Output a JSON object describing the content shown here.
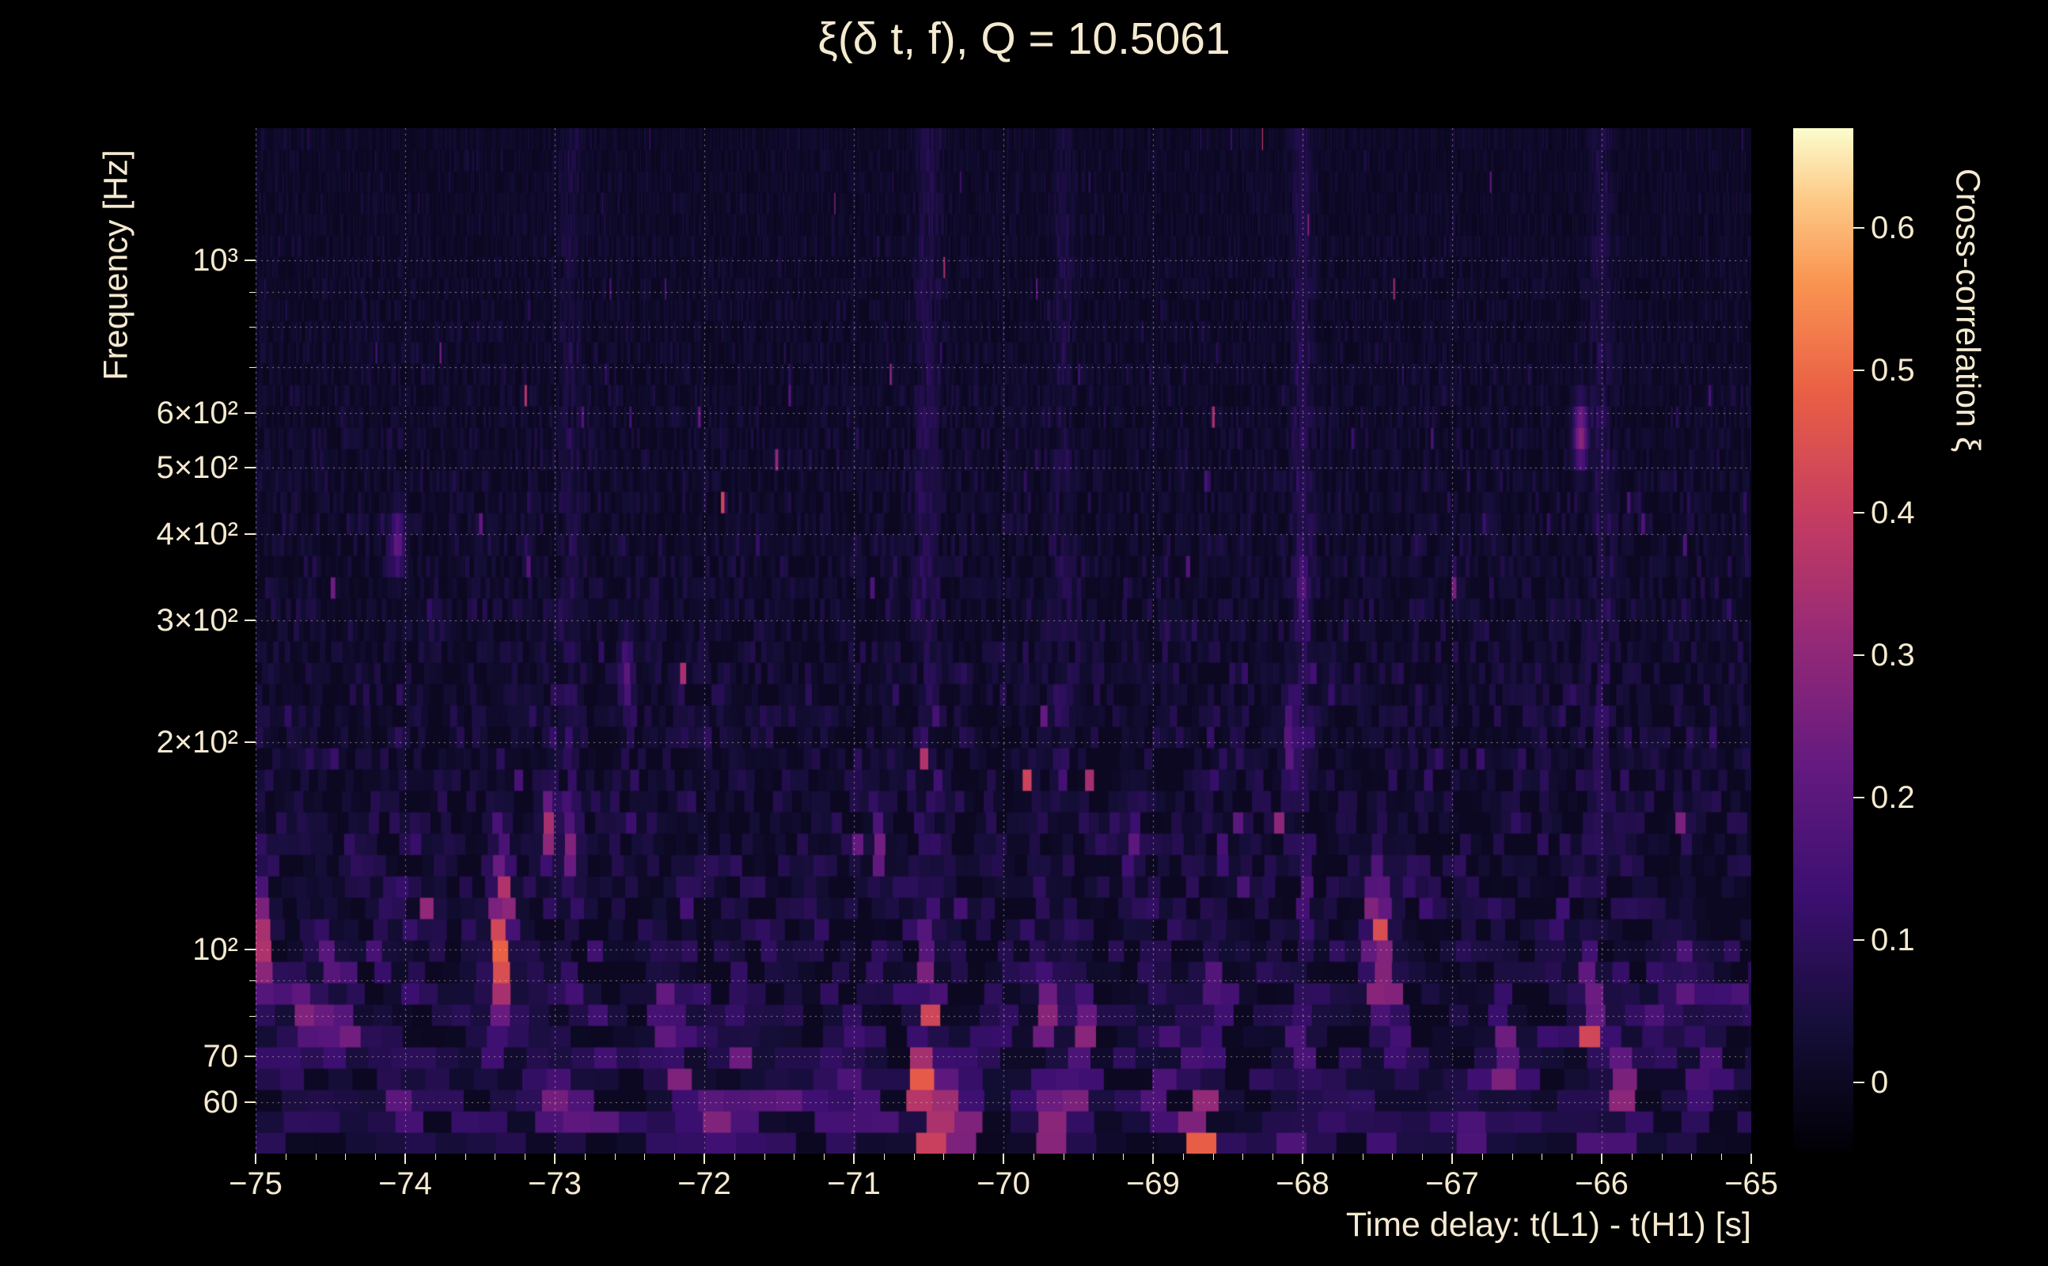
{
  "chart_data": {
    "type": "heatmap",
    "title": "ξ(δ t, f), Q = 10.5061",
    "q": 10.5061,
    "xlabel": "Time delay: t(L1) - t(H1) [s]",
    "ylabel": "Frequency [Hz]",
    "x_range": [
      -75,
      -65
    ],
    "y_range": [
      50.5,
      1555
    ],
    "y_scale": "log",
    "x_ticks": [
      {
        "t": -75,
        "label": "−75"
      },
      {
        "t": -74,
        "label": "−74"
      },
      {
        "t": -73,
        "label": "−73"
      },
      {
        "t": -72,
        "label": "−72"
      },
      {
        "t": -71,
        "label": "−71"
      },
      {
        "t": -70,
        "label": "−70"
      },
      {
        "t": -69,
        "label": "−69"
      },
      {
        "t": -68,
        "label": "−68"
      },
      {
        "t": -67,
        "label": "−67"
      },
      {
        "t": -66,
        "label": "−66"
      },
      {
        "t": -65,
        "label": "−65"
      }
    ],
    "x_minor_step": 0.2,
    "y_major_ticks": [
      {
        "f": 1000,
        "label": "10³"
      },
      {
        "f": 600,
        "label": "6×10²"
      },
      {
        "f": 500,
        "label": "5×10²"
      },
      {
        "f": 400,
        "label": "4×10²"
      },
      {
        "f": 300,
        "label": "3×10²"
      },
      {
        "f": 200,
        "label": "2×10²"
      },
      {
        "f": 100,
        "label": "10²"
      },
      {
        "f": 70,
        "label": "70"
      },
      {
        "f": 60,
        "label": "60"
      }
    ],
    "y_minor_ticks": [
      900,
      800,
      700,
      90,
      80
    ],
    "grid_freqs": [
      60,
      70,
      80,
      90,
      100,
      200,
      300,
      400,
      500,
      600,
      700,
      800,
      900,
      1000
    ],
    "grid_on": true,
    "colorbar": {
      "label": "Cross-correlation ξ",
      "vmin": -0.05,
      "vmax": 0.67,
      "ticks": [
        {
          "v": 0.6,
          "label": "0.6"
        },
        {
          "v": 0.5,
          "label": "0.5"
        },
        {
          "v": 0.4,
          "label": "0.4"
        },
        {
          "v": 0.3,
          "label": "0.3"
        },
        {
          "v": 0.2,
          "label": "0.2"
        },
        {
          "v": 0.1,
          "label": "0.1"
        },
        {
          "v": 0.0,
          "label": "0"
        }
      ]
    },
    "colormap": "magma",
    "colormap_stops": [
      [
        0.0,
        [
          0,
          0,
          4
        ]
      ],
      [
        0.12,
        [
          20,
          14,
          54
        ]
      ],
      [
        0.25,
        [
          59,
          15,
          112
        ]
      ],
      [
        0.38,
        [
          101,
          26,
          128
        ]
      ],
      [
        0.5,
        [
          148,
          41,
          119
        ]
      ],
      [
        0.62,
        [
          196,
          60,
          98
        ]
      ],
      [
        0.74,
        [
          233,
          94,
          69
        ]
      ],
      [
        0.85,
        [
          250,
          148,
          82
        ]
      ],
      [
        0.93,
        [
          253,
          201,
          134
        ]
      ],
      [
        1.0,
        [
          252,
          252,
          205
        ]
      ]
    ],
    "noise": {
      "seed": 1226,
      "rows": 48,
      "base_sigma": 0.018,
      "lowfreq_sigma": 0.05,
      "base_mean": 0.012,
      "lowfreq_mean": 0.02,
      "spike_prob_hi": 0.004,
      "spike_prob_lo": 0.025,
      "spike_scale": 0.35
    },
    "bands": [
      {
        "x": -72.9,
        "v": 0.04,
        "dx": 0.05
      },
      {
        "x": -70.5,
        "v": 0.055,
        "dx": 0.06
      },
      {
        "x": -69.6,
        "v": 0.04,
        "dx": 0.05
      },
      {
        "x": -68.0,
        "v": 0.06,
        "dx": 0.05
      },
      {
        "x": -66.0,
        "v": 0.05,
        "dx": 0.05
      }
    ],
    "hotspots": [
      {
        "x": -74.97,
        "f": 100,
        "v": 0.44
      },
      {
        "x": -74.8,
        "f": 60,
        "v": 0.25
      },
      {
        "x": -74.67,
        "f": 83,
        "v": 0.28
      },
      {
        "x": -74.52,
        "f": 86,
        "v": 0.31
      },
      {
        "x": -74.38,
        "f": 79,
        "v": 0.28
      },
      {
        "x": -74.05,
        "f": 390,
        "v": 0.22,
        "do": 0.12
      },
      {
        "x": -74.02,
        "f": 55,
        "v": 0.3
      },
      {
        "x": -73.42,
        "f": 84,
        "v": 0.3
      },
      {
        "x": -73.35,
        "f": 104,
        "v": 0.52,
        "dx": 0.045,
        "do": 0.3
      },
      {
        "x": -73.17,
        "f": 77,
        "v": 0.33
      },
      {
        "x": -73.03,
        "f": 150,
        "v": 0.36,
        "do": 0.15
      },
      {
        "x": -73.0,
        "f": 55,
        "v": 0.3
      },
      {
        "x": -72.88,
        "f": 140,
        "v": 0.3,
        "do": 0.15
      },
      {
        "x": -72.52,
        "f": 250,
        "v": 0.2,
        "do": 0.15
      },
      {
        "x": -72.28,
        "f": 81,
        "v": 0.28
      },
      {
        "x": -72.16,
        "f": 70,
        "v": 0.31
      },
      {
        "x": -71.93,
        "f": 55,
        "v": 0.3
      },
      {
        "x": -71.75,
        "f": 64,
        "v": 0.28
      },
      {
        "x": -71.44,
        "f": 55,
        "v": 0.26
      },
      {
        "x": -71.13,
        "f": 58,
        "v": 0.28
      },
      {
        "x": -70.95,
        "f": 63,
        "v": 0.3
      },
      {
        "x": -70.83,
        "f": 140,
        "v": 0.25,
        "do": 0.15
      },
      {
        "x": -70.52,
        "f": 57,
        "v": 0.67,
        "dx": 0.04,
        "do": 0.32
      },
      {
        "x": -70.5,
        "f": 80,
        "v": 0.45,
        "do": 0.25
      },
      {
        "x": -70.4,
        "f": 55,
        "v": 0.42
      },
      {
        "x": -70.26,
        "f": 56,
        "v": 0.36
      },
      {
        "x": -69.71,
        "f": 78,
        "v": 0.3
      },
      {
        "x": -69.68,
        "f": 55,
        "v": 0.3
      },
      {
        "x": -69.54,
        "f": 56,
        "v": 0.36
      },
      {
        "x": -69.45,
        "f": 72,
        "v": 0.3
      },
      {
        "x": -69.14,
        "f": 140,
        "v": 0.22,
        "do": 0.15
      },
      {
        "x": -68.96,
        "f": 62,
        "v": 0.3
      },
      {
        "x": -68.69,
        "f": 57,
        "v": 0.56,
        "dx": 0.04,
        "do": 0.28
      },
      {
        "x": -68.57,
        "f": 83,
        "v": 0.3
      },
      {
        "x": -68.08,
        "f": 200,
        "v": 0.22,
        "do": 0.2
      },
      {
        "x": -68.0,
        "f": 340,
        "v": 0.2,
        "do": 0.12
      },
      {
        "x": -67.5,
        "f": 103,
        "v": 0.5,
        "dx": 0.045,
        "do": 0.25
      },
      {
        "x": -67.4,
        "f": 83,
        "v": 0.3
      },
      {
        "x": -66.8,
        "f": 55,
        "v": 0.28
      },
      {
        "x": -66.66,
        "f": 70,
        "v": 0.3
      },
      {
        "x": -66.14,
        "f": 560,
        "v": 0.3,
        "do": 0.12
      },
      {
        "x": -66.08,
        "f": 77,
        "v": 0.43,
        "do": 0.25
      },
      {
        "x": -65.86,
        "f": 62,
        "v": 0.3
      },
      {
        "x": -65.61,
        "f": 80,
        "v": 0.3
      },
      {
        "x": -65.47,
        "f": 88,
        "v": 0.3
      },
      {
        "x": -65.33,
        "f": 72,
        "v": 0.28
      }
    ]
  },
  "style": {
    "background": "#000000",
    "text_color": "#f5ead0",
    "grid_color": "rgba(244,234,214,0.55)"
  }
}
